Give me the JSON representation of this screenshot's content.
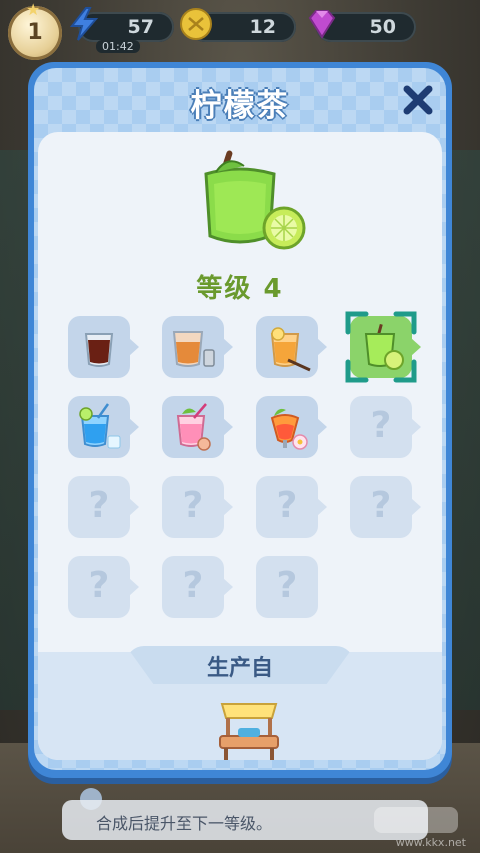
{
  "hud": {
    "player_level": "1",
    "energy": "57",
    "timer": "01:42",
    "coins": "12",
    "gems": "50"
  },
  "dialog": {
    "title": "柠檬茶",
    "level_label": "等级 4",
    "produced_from_label": "生产自"
  },
  "chain": {
    "items": [
      {
        "name": "cola-drink",
        "known": true
      },
      {
        "name": "iced-tea-with-shot",
        "known": true
      },
      {
        "name": "orange-juice-with-straw",
        "known": true
      },
      {
        "name": "lemon-tea",
        "known": true,
        "selected": true
      },
      {
        "name": "blue-cocktail",
        "known": true
      },
      {
        "name": "pink-mojito",
        "known": true
      },
      {
        "name": "tropical-cocktail",
        "known": true
      },
      {
        "name": "unknown",
        "known": false,
        "mark": "?"
      },
      {
        "name": "unknown",
        "known": false,
        "mark": "?"
      },
      {
        "name": "unknown",
        "known": false,
        "mark": "?"
      },
      {
        "name": "unknown",
        "known": false,
        "mark": "?"
      },
      {
        "name": "unknown",
        "known": false,
        "mark": "?"
      },
      {
        "name": "unknown",
        "known": false,
        "mark": "?"
      },
      {
        "name": "unknown",
        "known": false,
        "mark": "?"
      },
      {
        "name": "unknown",
        "known": false,
        "mark": "?"
      }
    ]
  },
  "tip": {
    "text": "合成后提升至下一等级。"
  },
  "watermark": "www.kkx.net",
  "colors": {
    "dialog_blue": "#3f86d6",
    "level_green": "#6a9a2e",
    "selected_green": "#8bd36a"
  }
}
